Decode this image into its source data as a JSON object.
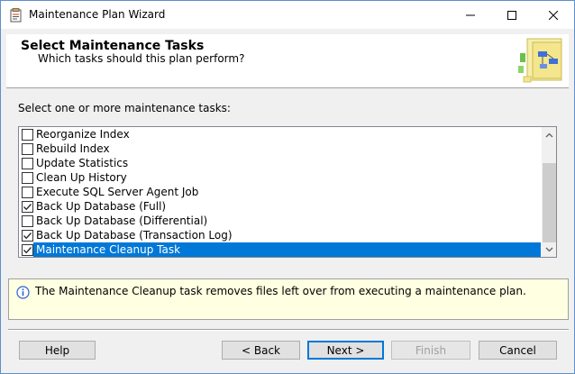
{
  "window": {
    "title": "Maintenance Plan Wizard"
  },
  "header": {
    "title": "Select Maintenance Tasks",
    "subtitle": "Which tasks should this plan perform?"
  },
  "prompt": "Select one or more maintenance tasks:",
  "tasks": [
    {
      "label": "Reorganize Index",
      "checked": false,
      "selected": false
    },
    {
      "label": "Rebuild Index",
      "checked": false,
      "selected": false
    },
    {
      "label": "Update Statistics",
      "checked": false,
      "selected": false
    },
    {
      "label": "Clean Up History",
      "checked": false,
      "selected": false
    },
    {
      "label": "Execute SQL Server Agent Job",
      "checked": false,
      "selected": false
    },
    {
      "label": "Back Up Database (Full)",
      "checked": true,
      "selected": false
    },
    {
      "label": "Back Up Database (Differential)",
      "checked": false,
      "selected": false
    },
    {
      "label": "Back Up Database (Transaction Log)",
      "checked": true,
      "selected": false
    },
    {
      "label": "Maintenance Cleanup Task",
      "checked": true,
      "selected": true
    }
  ],
  "info": {
    "text": "The Maintenance Cleanup task removes files left over from executing a maintenance plan."
  },
  "buttons": {
    "help": "Help",
    "back": "< Back",
    "next": "Next >",
    "finish": "Finish",
    "cancel": "Cancel"
  },
  "colors": {
    "selection": "#0078d7",
    "info_background": "#ffffe1"
  }
}
